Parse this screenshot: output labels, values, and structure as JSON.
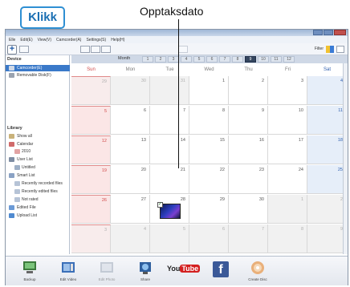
{
  "callouts": {
    "klikk": "Klikk",
    "opptaksdato": "Opptaksdato"
  },
  "menubar": [
    "Elle",
    "Edit(E)",
    "View(V)",
    "Camcorder(A)",
    "Settings(S)",
    "Help(H)"
  ],
  "toolbar": {
    "filter_label": "Filter",
    "add_button": "+"
  },
  "sidebar": {
    "devices_heading": "Device",
    "devices": [
      {
        "label": "Camcorder(E)",
        "selected": true
      },
      {
        "label": "Removable Disk(F)",
        "selected": false
      }
    ],
    "library_heading": "Library",
    "library_items": [
      {
        "label": "Show all"
      },
      {
        "label": "Calendar"
      },
      {
        "label": "2010"
      },
      {
        "label": "User List"
      },
      {
        "label": "Untitled"
      },
      {
        "label": "Smart List"
      },
      {
        "label": "Recently recorded files"
      },
      {
        "label": "Recently edited files"
      },
      {
        "label": "Not rated"
      },
      {
        "label": "Edited File"
      },
      {
        "label": "Upload List"
      }
    ]
  },
  "calendar": {
    "month_label": "Month",
    "nav_numbers": [
      "1",
      "2",
      "3",
      "4",
      "5",
      "6",
      "7",
      "8",
      "9",
      "10",
      "11",
      "12"
    ],
    "current_month_index": 8,
    "weekdays": [
      "Sun",
      "Mon",
      "Tue",
      "Wed",
      "Thu",
      "Fri",
      "Sat"
    ],
    "weeks": [
      [
        {
          "d": "29",
          "o": true
        },
        {
          "d": "30",
          "o": true
        },
        {
          "d": "31",
          "o": true
        },
        {
          "d": "1"
        },
        {
          "d": "2"
        },
        {
          "d": "3"
        },
        {
          "d": "4"
        }
      ],
      [
        {
          "d": "5"
        },
        {
          "d": "6"
        },
        {
          "d": "7"
        },
        {
          "d": "8"
        },
        {
          "d": "9"
        },
        {
          "d": "10"
        },
        {
          "d": "11"
        }
      ],
      [
        {
          "d": "12"
        },
        {
          "d": "13"
        },
        {
          "d": "14"
        },
        {
          "d": "15"
        },
        {
          "d": "16"
        },
        {
          "d": "17"
        },
        {
          "d": "18"
        }
      ],
      [
        {
          "d": "19"
        },
        {
          "d": "20"
        },
        {
          "d": "21"
        },
        {
          "d": "22"
        },
        {
          "d": "23"
        },
        {
          "d": "24"
        },
        {
          "d": "25"
        }
      ],
      [
        {
          "d": "26"
        },
        {
          "d": "27"
        },
        {
          "d": "28",
          "thumb": true
        },
        {
          "d": "29"
        },
        {
          "d": "30"
        },
        {
          "d": "1",
          "o": true
        },
        {
          "d": "2",
          "o": true
        }
      ],
      [
        {
          "d": "3",
          "o": true
        },
        {
          "d": "4",
          "o": true
        },
        {
          "d": "5",
          "o": true
        },
        {
          "d": "6",
          "o": true
        },
        {
          "d": "7",
          "o": true
        },
        {
          "d": "8",
          "o": true
        },
        {
          "d": "9",
          "o": true
        }
      ]
    ]
  },
  "bottombar": [
    {
      "label": "Backup",
      "icon": "backup-icon"
    },
    {
      "label": "Edit Video",
      "icon": "edit-video-icon"
    },
    {
      "label": "Edit Photo",
      "icon": "edit-photo-icon"
    },
    {
      "label": "Share",
      "icon": "share-icon"
    },
    {
      "label": "",
      "icon": "youtube-icon"
    },
    {
      "label": "",
      "icon": "facebook-icon"
    },
    {
      "label": "Create Disc",
      "icon": "create-disc-icon"
    }
  ]
}
